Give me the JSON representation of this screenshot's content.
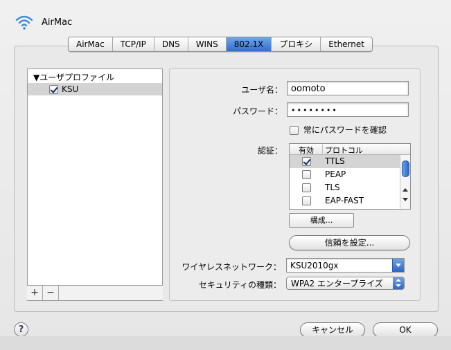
{
  "window": {
    "title": "AirMac"
  },
  "tabs": [
    {
      "label": "AirMac",
      "active": false
    },
    {
      "label": "TCP/IP",
      "active": false
    },
    {
      "label": "DNS",
      "active": false
    },
    {
      "label": "WINS",
      "active": false
    },
    {
      "label": "802.1X",
      "active": true
    },
    {
      "label": "プロキシ",
      "active": false
    },
    {
      "label": "Ethernet",
      "active": false
    }
  ],
  "profiles": {
    "group_label": "▼ユーザプロファイル",
    "items": [
      {
        "label": "KSU",
        "checked": true
      }
    ],
    "add_label": "+",
    "remove_label": "−"
  },
  "form": {
    "username_label": "ユーザ名：",
    "username_value": "oomoto",
    "password_label": "パスワード：",
    "password_value": "••••••••",
    "always_confirm_label": "常にパスワードを確認",
    "always_confirm_checked": false,
    "auth_label": "認証：",
    "auth_columns": {
      "enabled": "有効",
      "protocol": "プロトコル"
    },
    "auth_rows": [
      {
        "protocol": "TTLS",
        "enabled": true,
        "selected": true
      },
      {
        "protocol": "PEAP",
        "enabled": false,
        "selected": false
      },
      {
        "protocol": "TLS",
        "enabled": false,
        "selected": false
      },
      {
        "protocol": "EAP-FAST",
        "enabled": false,
        "selected": false
      }
    ],
    "configure_label": "構成...",
    "trust_label": "信頼を設定...",
    "wireless_label": "ワイヤレスネットワーク：",
    "wireless_value": "KSU2010gx",
    "security_label": "セキュリティの種類：",
    "security_value": "WPA2 エンタープライズ"
  },
  "footer": {
    "help_label": "?",
    "cancel_label": "キャンセル",
    "ok_label": "OK"
  },
  "colors": {
    "accent": "#2f6fcf",
    "selection": "#d4d4d4"
  }
}
